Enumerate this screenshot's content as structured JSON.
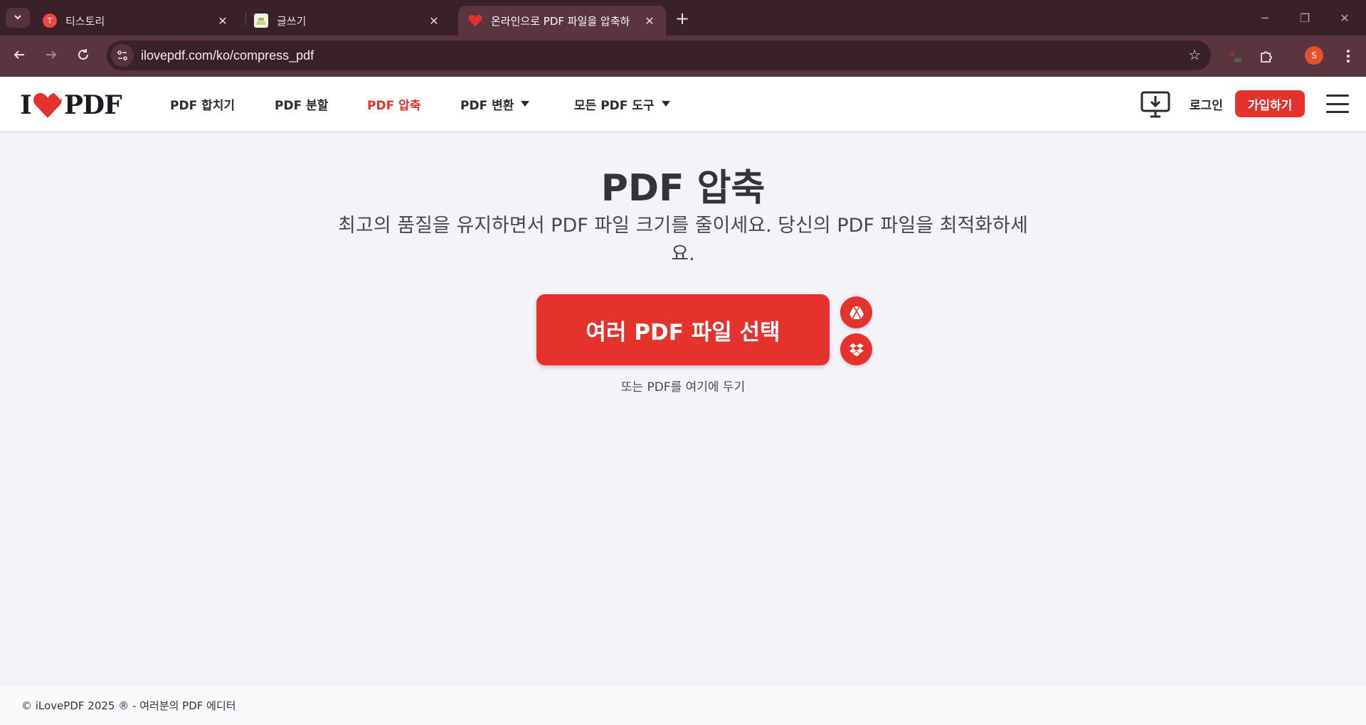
{
  "browser": {
    "tabs": [
      {
        "title": "티스토리",
        "favicon": "tistory-icon",
        "active": false
      },
      {
        "title": "글쓰기",
        "favicon": "page-icon",
        "active": false
      },
      {
        "title": "온라인으로 PDF 파일을 압축하",
        "favicon": "ilovepdf-heart-icon",
        "active": true
      }
    ],
    "new_tab_label": "+",
    "url": "ilovepdf.com/ko/compress_pdf",
    "profile_initial": "S",
    "colors": {
      "chrome_dark": "#3a2028",
      "chrome_toolbar": "#5a343e",
      "avatar": "#e6502a"
    }
  },
  "site": {
    "brand": {
      "before": "I",
      "after": "PDF",
      "accent": "#e5322d"
    },
    "nav": [
      {
        "label": "PDF 합치기",
        "active": false,
        "dropdown": false
      },
      {
        "label": "PDF 분할",
        "active": false,
        "dropdown": false
      },
      {
        "label": "PDF 압축",
        "active": true,
        "dropdown": false
      },
      {
        "label": "PDF 변환",
        "active": false,
        "dropdown": true
      },
      {
        "label": "모든 PDF 도구",
        "active": false,
        "dropdown": true
      }
    ],
    "login_label": "로그인",
    "signup_label": "가입하기"
  },
  "main": {
    "title": "PDF 압축",
    "subtitle": "최고의 품질을 유지하면서 PDF 파일 크기를 줄이세요. 당신의 PDF 파일을 최적화하세요.",
    "select_button": "여러 PDF 파일 선택",
    "cloud_sources": [
      "google-drive-icon",
      "dropbox-icon"
    ],
    "drop_hint": "또는 PDF를 여기에 두기"
  },
  "footer": {
    "copyright": "© iLovePDF 2025 ® - 여러분의 PDF 에디터"
  }
}
